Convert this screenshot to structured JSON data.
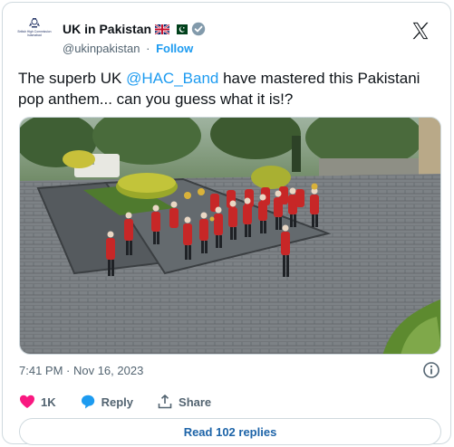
{
  "account": {
    "display_name": "UK in Pakistan",
    "handle": "@ukinpakistan",
    "separator": "·",
    "follow_label": "Follow",
    "crest_caption": "British High Commission Islamabad"
  },
  "tweet": {
    "text_before": "The superb UK ",
    "mention": "@HAC_Band",
    "text_after": " have mastered this Pakistani pop anthem... can you guess what it is!?",
    "timestamp": "7:41 PM · Nov 16, 2023"
  },
  "actions": {
    "like_count": "1K",
    "reply_label": "Reply",
    "share_label": "Share"
  },
  "replies_button": {
    "label": "Read 102 replies"
  },
  "colors": {
    "accent": "#1d9bf0",
    "like": "#f91880",
    "band_uniform": "#d42a2a"
  },
  "media": {
    "description_icon": "video-thumbnail"
  }
}
